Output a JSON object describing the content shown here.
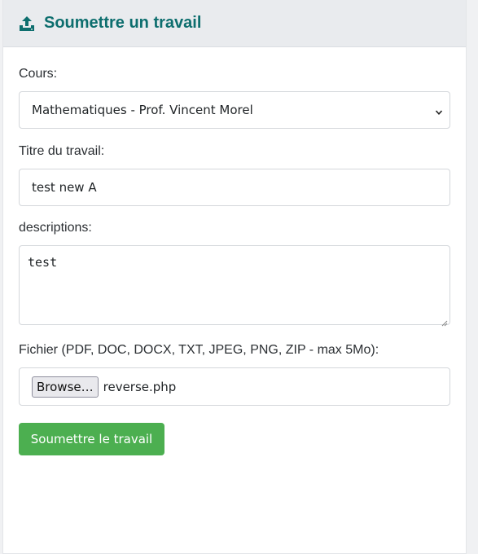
{
  "header": {
    "title": "Soumettre un travail",
    "icon": "upload-icon",
    "title_color": "#0d6e6e"
  },
  "form": {
    "course_label": "Cours:",
    "course_value": "Mathematiques - Prof. Vincent Morel",
    "title_label": "Titre du travail:",
    "title_value": "test new A",
    "description_label": "descriptions:",
    "description_value": "test",
    "file_label": "Fichier (PDF, DOC, DOCX, TXT, JPEG, PNG, ZIP - max 5Mo):",
    "browse_label": "Browse…",
    "file_name": "reverse.php",
    "submit_label": "Soumettre le travail",
    "submit_color": "#4caf50"
  }
}
